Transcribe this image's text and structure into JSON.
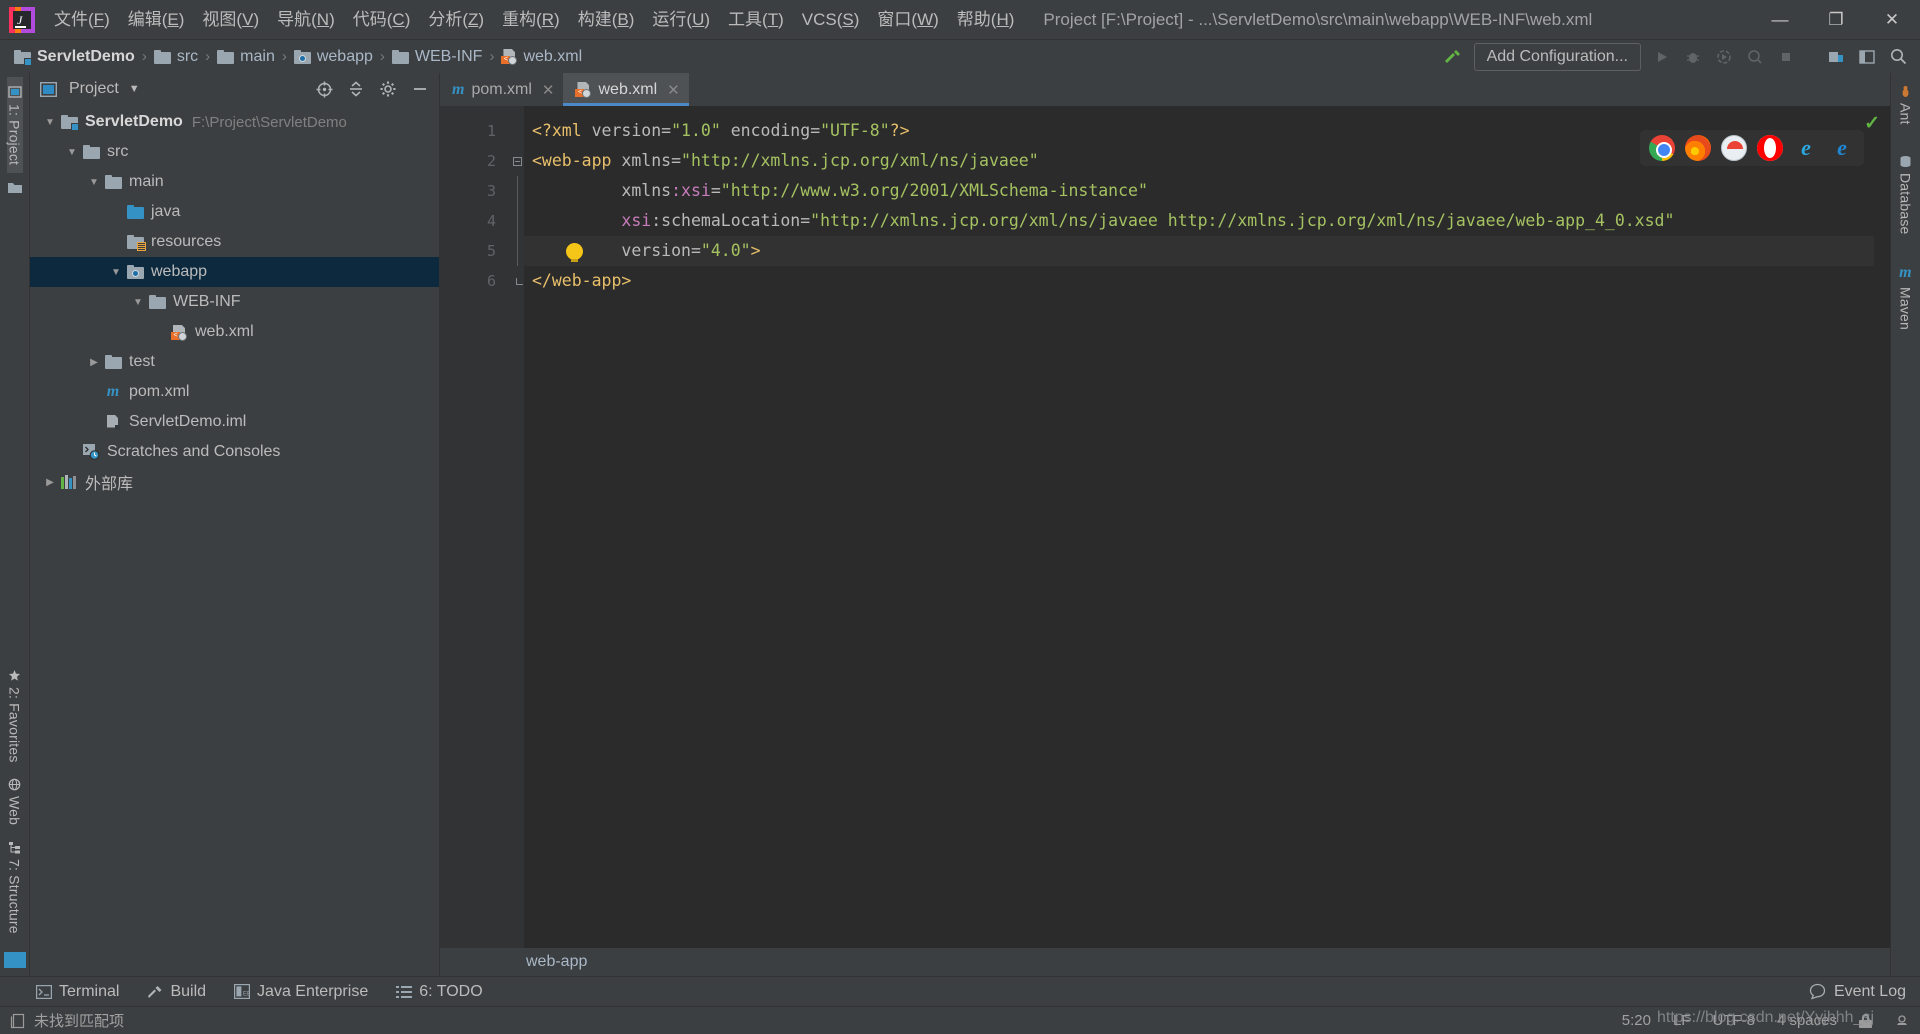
{
  "app": {
    "logo_letter": "IJ",
    "window_title": "Project [F:\\Project] - ...\\ServletDemo\\src\\main\\webapp\\WEB-INF\\web.xml"
  },
  "menubar": [
    {
      "label": "文件(F)",
      "name": "menu-file"
    },
    {
      "label": "编辑(E)",
      "name": "menu-edit"
    },
    {
      "label": "视图(V)",
      "name": "menu-view"
    },
    {
      "label": "导航(N)",
      "name": "menu-navigate"
    },
    {
      "label": "代码(C)",
      "name": "menu-code"
    },
    {
      "label": "分析(Z)",
      "name": "menu-analyze"
    },
    {
      "label": "重构(R)",
      "name": "menu-refactor"
    },
    {
      "label": "构建(B)",
      "name": "menu-build"
    },
    {
      "label": "运行(U)",
      "name": "menu-run"
    },
    {
      "label": "工具(T)",
      "name": "menu-tools"
    },
    {
      "label": "VCS(S)",
      "name": "menu-vcs"
    },
    {
      "label": "窗口(W)",
      "name": "menu-window"
    },
    {
      "label": "帮助(H)",
      "name": "menu-help"
    }
  ],
  "window_controls": {
    "minimize": "—",
    "maximize": "❐",
    "close": "✕"
  },
  "breadcrumb": {
    "items": [
      {
        "label": "ServletDemo",
        "icon": "folder-module-icon",
        "bold": true
      },
      {
        "label": "src",
        "icon": "folder-icon",
        "bold": false
      },
      {
        "label": "main",
        "icon": "folder-icon",
        "bold": false
      },
      {
        "label": "webapp",
        "icon": "folder-web-icon",
        "bold": false
      },
      {
        "label": "WEB-INF",
        "icon": "folder-icon",
        "bold": false
      },
      {
        "label": "web.xml",
        "icon": "xml-file-icon",
        "bold": false
      }
    ],
    "separator": "›"
  },
  "toolbar": {
    "add_configuration": "Add Configuration...",
    "run_icon": "run-icon",
    "debug_icon": "debug-icon",
    "run_coverage_icon": "run-with-coverage-icon",
    "profile_icon": "profile-icon",
    "stop_icon": "stop-icon",
    "updates_icon": "updates-icon",
    "layout_icon": "restore-layout-icon",
    "search_icon": "search-everywhere-icon",
    "hammer_icon": "build-hammer-icon"
  },
  "left_strip": {
    "tabs": [
      {
        "label": "1: Project",
        "name": "tool-tab-project",
        "selected": true,
        "icon": "project-icon"
      },
      {
        "label": "2: Favorites",
        "name": "tool-tab-favorites",
        "selected": false,
        "icon": "star-icon"
      },
      {
        "label": "Web",
        "name": "tool-tab-web",
        "selected": false,
        "icon": "web-icon"
      },
      {
        "label": "7: Structure",
        "name": "tool-tab-structure",
        "selected": false,
        "icon": "structure-icon"
      }
    ]
  },
  "right_strip": {
    "tabs": [
      {
        "label": "Ant",
        "name": "tool-tab-ant",
        "icon": "ant-icon"
      },
      {
        "label": "Database",
        "name": "tool-tab-database",
        "icon": "database-icon"
      },
      {
        "label": "Maven",
        "name": "tool-tab-maven",
        "icon": "maven-icon"
      }
    ]
  },
  "project_panel": {
    "title": "Project",
    "dropdown_icon": "chevron-down-icon",
    "locate_icon": "scroll-from-source-icon",
    "collapse_icon": "collapse-all-icon",
    "settings_icon": "gear-icon",
    "hide_icon": "hide-icon",
    "tree": [
      {
        "label": "ServletDemo",
        "path": "F:\\Project\\ServletDemo",
        "indent": 0,
        "arrow": "down",
        "icon": "folder-module-icon",
        "bold": true,
        "selected": false
      },
      {
        "label": "src",
        "path": "",
        "indent": 1,
        "arrow": "down",
        "icon": "folder-icon",
        "bold": false,
        "selected": false
      },
      {
        "label": "main",
        "path": "",
        "indent": 2,
        "arrow": "down",
        "icon": "folder-icon",
        "bold": false,
        "selected": false
      },
      {
        "label": "java",
        "path": "",
        "indent": 3,
        "arrow": "none",
        "icon": "folder-source-icon",
        "bold": false,
        "selected": false
      },
      {
        "label": "resources",
        "path": "",
        "indent": 3,
        "arrow": "none",
        "icon": "folder-resources-icon",
        "bold": false,
        "selected": false
      },
      {
        "label": "webapp",
        "path": "",
        "indent": 3,
        "arrow": "down",
        "icon": "folder-web-icon",
        "bold": false,
        "selected": true
      },
      {
        "label": "WEB-INF",
        "path": "",
        "indent": 4,
        "arrow": "down",
        "icon": "folder-icon",
        "bold": false,
        "selected": false
      },
      {
        "label": "web.xml",
        "path": "",
        "indent": 5,
        "arrow": "none",
        "icon": "xml-file-icon",
        "bold": false,
        "selected": false
      },
      {
        "label": "test",
        "path": "",
        "indent": 2,
        "arrow": "right",
        "icon": "folder-icon",
        "bold": false,
        "selected": false
      },
      {
        "label": "pom.xml",
        "path": "",
        "indent": 2,
        "arrow": "none",
        "icon": "maven-file-icon",
        "bold": false,
        "selected": false
      },
      {
        "label": "ServletDemo.iml",
        "path": "",
        "indent": 2,
        "arrow": "none",
        "icon": "iml-file-icon",
        "bold": false,
        "selected": false
      },
      {
        "label": "Scratches and Consoles",
        "path": "",
        "indent": 1,
        "arrow": "none",
        "icon": "scratches-icon",
        "bold": false,
        "selected": false
      },
      {
        "label": "外部库",
        "path": "",
        "indent": 0,
        "arrow": "right",
        "icon": "external-libraries-icon",
        "bold": false,
        "selected": false
      }
    ]
  },
  "editor": {
    "tabs": [
      {
        "label": "pom.xml",
        "icon": "maven-file-icon",
        "active": false,
        "close": "✕"
      },
      {
        "label": "web.xml",
        "icon": "xml-file-icon",
        "active": true,
        "close": "✕"
      }
    ],
    "line_numbers": [
      "1",
      "2",
      "3",
      "4",
      "5",
      "6"
    ],
    "code_lines": [
      {
        "n": 1,
        "indent": 0,
        "highlight": false,
        "bulb": false,
        "segments": [
          {
            "t": "<?xml ",
            "c": "pi"
          },
          {
            "t": "version",
            "c": "attr"
          },
          {
            "t": "=",
            "c": "eq"
          },
          {
            "t": "\"1.0\"",
            "c": "val"
          },
          {
            "t": " ",
            "c": "attr"
          },
          {
            "t": "encoding",
            "c": "attr"
          },
          {
            "t": "=",
            "c": "eq"
          },
          {
            "t": "\"UTF-8\"",
            "c": "val"
          },
          {
            "t": "?>",
            "c": "pi"
          }
        ]
      },
      {
        "n": 2,
        "indent": 0,
        "highlight": false,
        "bulb": false,
        "segments": [
          {
            "t": "<web-app",
            "c": "tag"
          },
          {
            "t": " xmlns",
            "c": "attr"
          },
          {
            "t": "=",
            "c": "eq"
          },
          {
            "t": "\"http://xmlns.jcp.org/xml/ns/javaee\"",
            "c": "val"
          }
        ]
      },
      {
        "n": 3,
        "indent": 0,
        "highlight": false,
        "bulb": false,
        "segments": [
          {
            "t": "         xmlns",
            "c": "attr"
          },
          {
            "t": ":xsi",
            "c": "attr2"
          },
          {
            "t": "=",
            "c": "eq"
          },
          {
            "t": "\"http://www.w3.org/2001/XMLSchema-instance\"",
            "c": "val"
          }
        ]
      },
      {
        "n": 4,
        "indent": 0,
        "highlight": false,
        "bulb": false,
        "segments": [
          {
            "t": "         ",
            "c": "attr"
          },
          {
            "t": "xsi",
            "c": "attr2"
          },
          {
            "t": ":schemaLocation",
            "c": "attr"
          },
          {
            "t": "=",
            "c": "eq"
          },
          {
            "t": "\"http://xmlns.jcp.org/xml/ns/javaee http://xmlns.jcp.org/xml/ns/javaee/web-app_4_0.xsd\"",
            "c": "val"
          }
        ]
      },
      {
        "n": 5,
        "indent": 0,
        "highlight": true,
        "bulb": true,
        "segments": [
          {
            "t": "         version",
            "c": "attr"
          },
          {
            "t": "=",
            "c": "eq"
          },
          {
            "t": "\"4.0\"",
            "c": "val"
          },
          {
            "t": ">",
            "c": "tag"
          }
        ]
      },
      {
        "n": 6,
        "indent": 0,
        "highlight": false,
        "bulb": false,
        "segments": [
          {
            "t": "</web-app>",
            "c": "tag"
          }
        ]
      }
    ],
    "breadcrumb_footer": "web-app",
    "browsers": [
      {
        "name": "chrome-icon",
        "cls": "chrome",
        "glyph": ""
      },
      {
        "name": "firefox-icon",
        "cls": "firefox",
        "glyph": ""
      },
      {
        "name": "safari-icon",
        "cls": "safari",
        "glyph": ""
      },
      {
        "name": "opera-icon",
        "cls": "opera",
        "glyph": ""
      },
      {
        "name": "internet-explorer-icon",
        "cls": "ie",
        "glyph": "e"
      },
      {
        "name": "edge-icon",
        "cls": "edge",
        "glyph": "e"
      }
    ],
    "inspection_ok": "✓"
  },
  "bottom_bar": {
    "items": [
      {
        "label": "Terminal",
        "icon": "terminal-icon",
        "name": "bottom-tab-terminal"
      },
      {
        "label": "Build",
        "icon": "build-hammer-icon",
        "name": "bottom-tab-build"
      },
      {
        "label": "Java Enterprise",
        "icon": "java-enterprise-icon",
        "name": "bottom-tab-java-enterprise"
      },
      {
        "label": "6: TODO",
        "icon": "todo-icon",
        "name": "bottom-tab-todo"
      }
    ],
    "event_log": "Event Log",
    "event_log_icon": "event-log-icon"
  },
  "status_bar": {
    "message": "未找到匹配项",
    "message_icon": "document-icon",
    "caret_position": "5:20",
    "line_separator": "LF",
    "encoding": "UTF-8",
    "indent": "4 spaces",
    "lock_icon": "lock-icon",
    "inspection_icon": "inspection-icon",
    "watermark": "https://blog.csdn.net/Yyjhhh_sj"
  },
  "colors": {
    "accent_blue": "#4a88c7",
    "selection_blue": "#0d293e",
    "panel_bg": "#3c3f41",
    "editor_bg": "#2b2b2b",
    "gutter_bg": "#313335",
    "text": "#bbbbbb",
    "string_green": "#a5c261",
    "tag_yellow": "#e8bf6a",
    "ns_purple": "#c77dbb",
    "green_run": "#62b543"
  }
}
